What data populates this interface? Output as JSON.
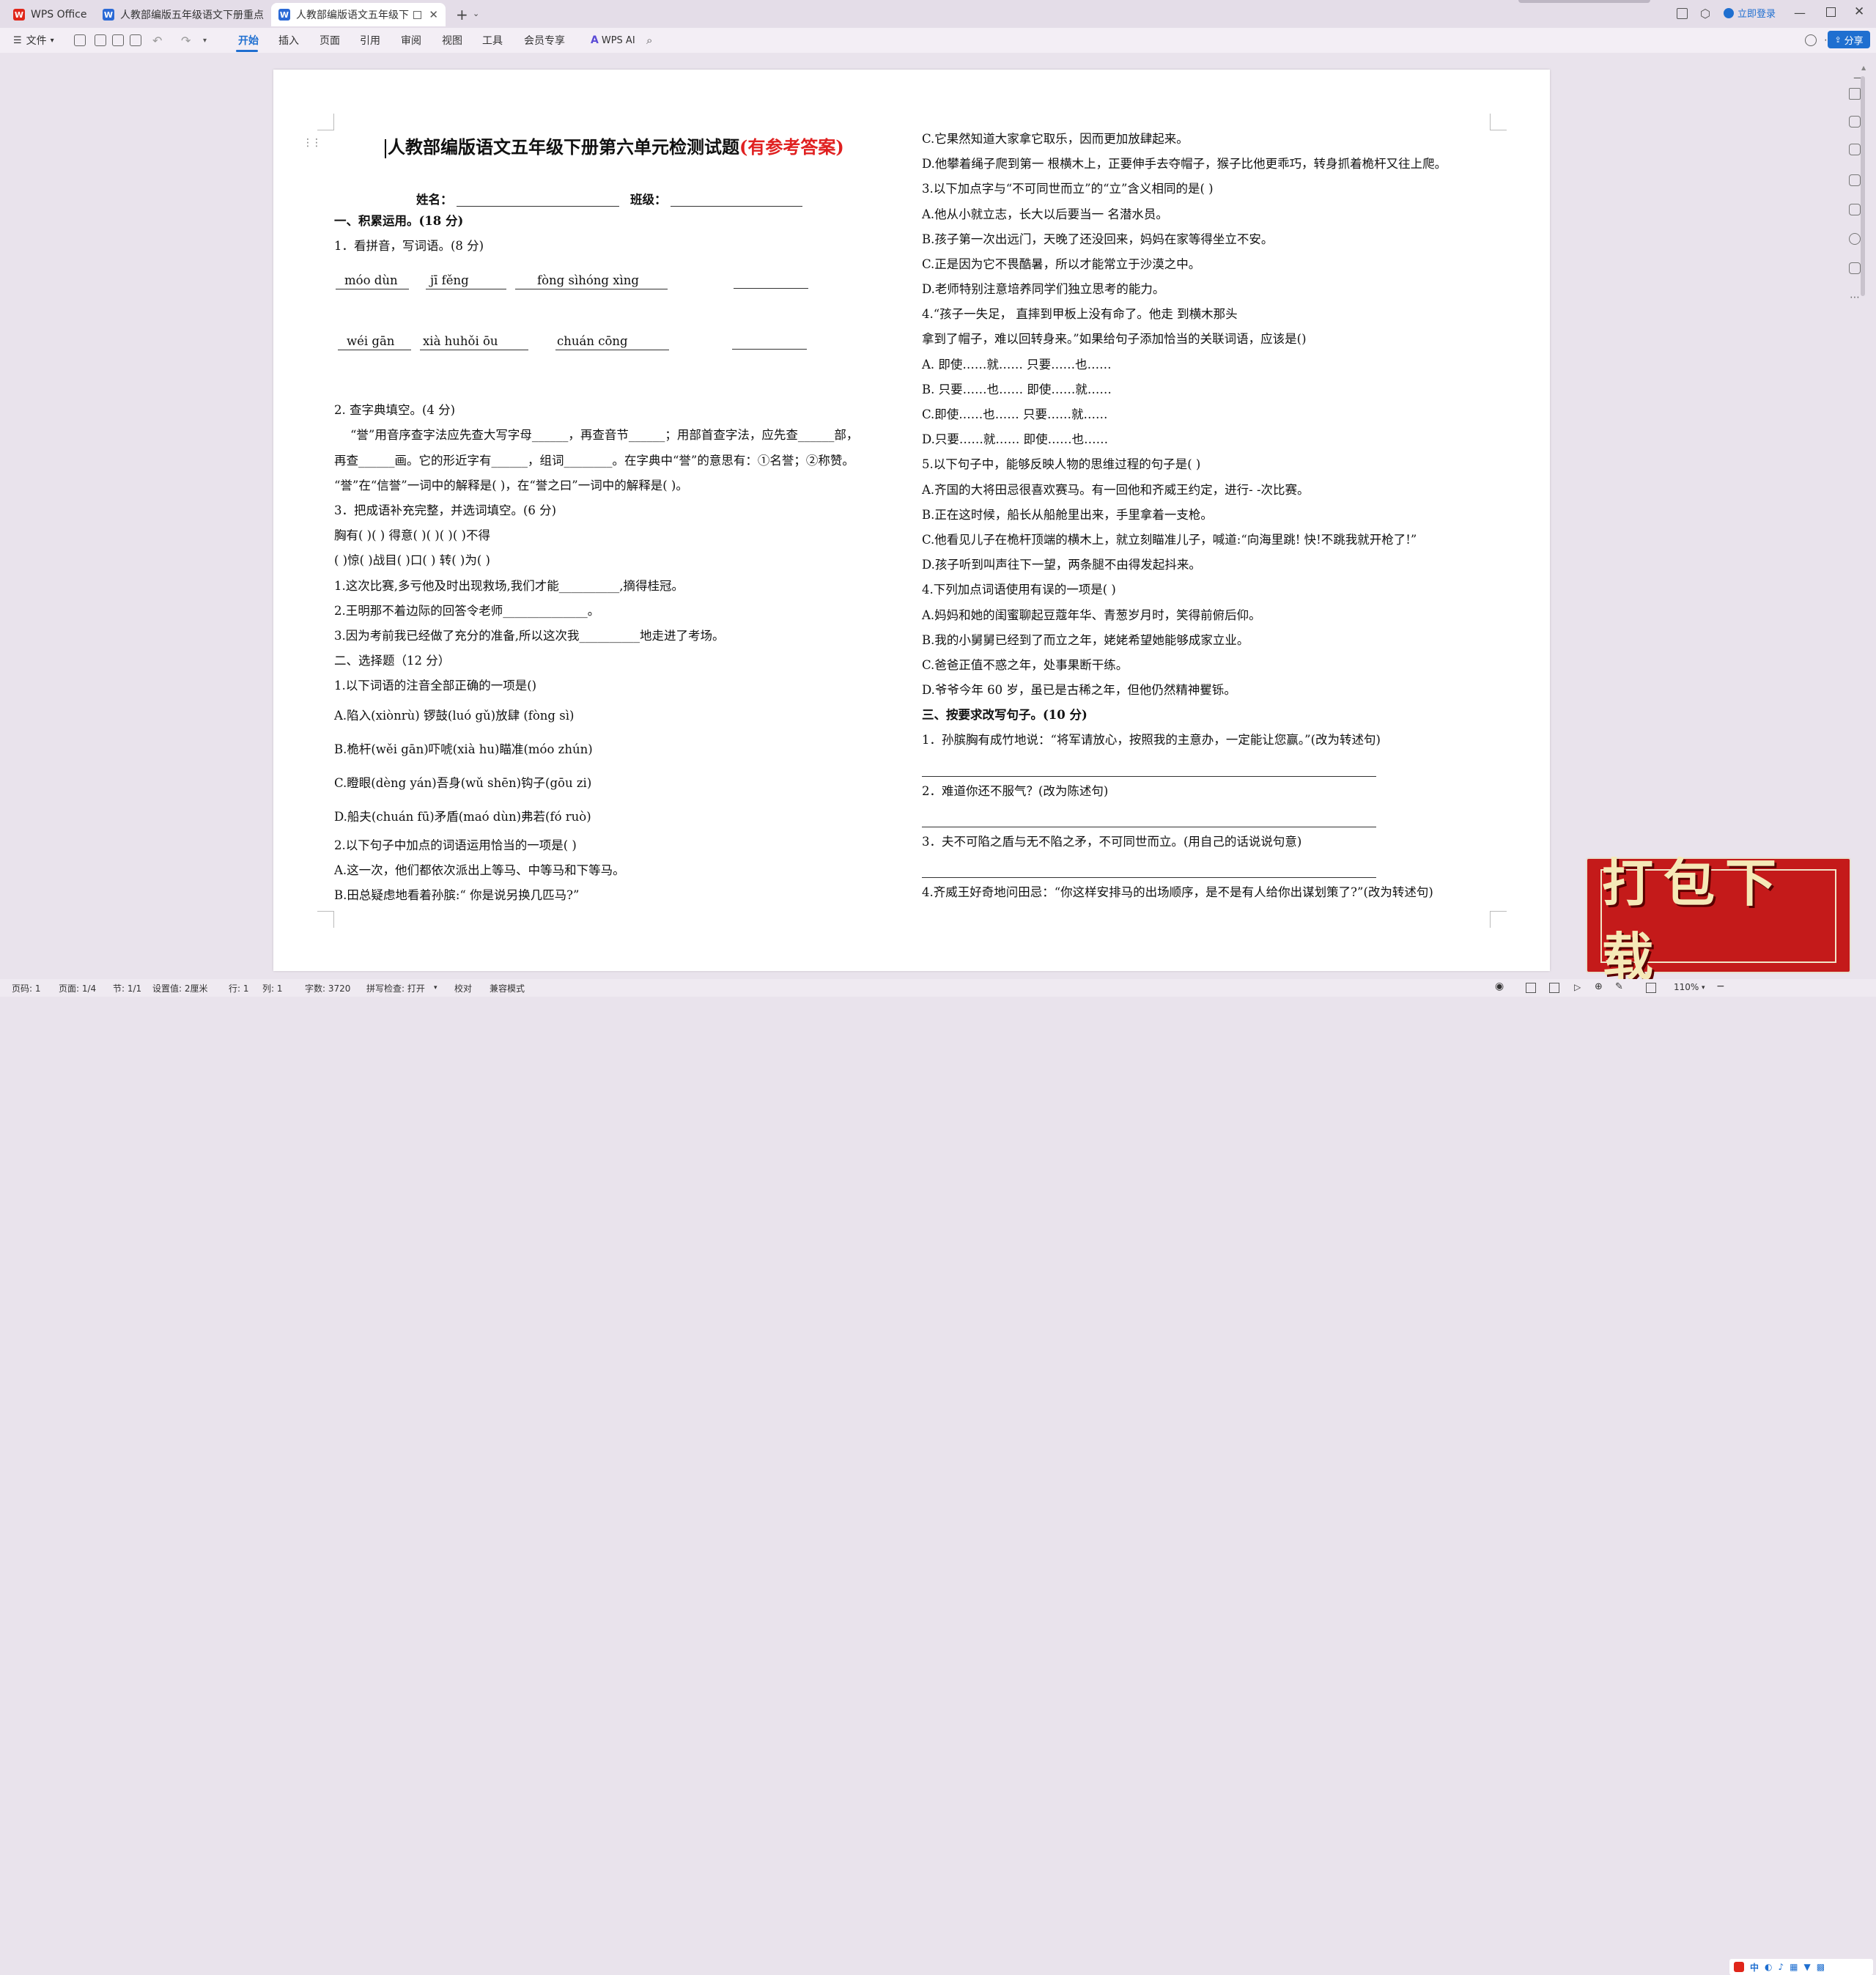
{
  "tabs": [
    {
      "label": "WPS Office"
    },
    {
      "label": "人教部编版五年级语文下册重点学校"
    },
    {
      "label": "人教部编版语文五年级下册第"
    }
  ],
  "titlebar": {
    "login": "立即登录",
    "share": "分享"
  },
  "ribbon": {
    "file": "文件",
    "menus": [
      "开始",
      "插入",
      "页面",
      "引用",
      "审阅",
      "视图",
      "工具",
      "会员专享"
    ],
    "ai": "WPS AI"
  },
  "doc": {
    "title": "人教部编版语文五年级下册第六单元检测试题",
    "title_suffix": "(有参考答案)",
    "name_label": "姓名：",
    "class_label": "班级：",
    "left": [
      {
        "t": "一、积累运用。(18 分)",
        "bold": true
      },
      {
        "t": "1．看拼音，写词语。(8 分)"
      },
      {
        "t": "2. 查字典填空。(4 分)"
      },
      {
        "t": "“誉”用音序查字法应先查大写字母______，再查音节______；用部首查字法，应先查______部，"
      },
      {
        "t": "再查______画。它的形近字有______，组词________。在字典中“誉”的意思有：①名誉；②称赞。"
      },
      {
        "t": "“誉”在“信誉”一词中的解释是(      )，在“誉之曰”一词中的解释是(      )。"
      },
      {
        "t": "3．把成语补充完整，并选词填空。(6 分)"
      },
      {
        "t": "胸有(      )(      )    得意(      )(      )(      )(      )不得"
      },
      {
        "t": "(      )惊(      )战目(      )口(      )    转(      )为(      )"
      },
      {
        "t": "1.这次比赛,多亏他及时出现救场,我们才能__________,摘得桂冠。"
      },
      {
        "t": "2.王明那不着边际的回答令老师______________。"
      },
      {
        "t": "3.因为考前我已经做了充分的准备,所以这次我__________地走进了考场。"
      },
      {
        "t": "二、选择题（12 分）"
      },
      {
        "t": "1.以下词语的注音全部正确的一项是()"
      },
      {
        "t": "A.陷入(xiònrù)  锣鼓(luó  gǔ)放肆  (fòng  sì)"
      },
      {
        "t": "B.桅杆(wěi  gān)吓唬(xià  hu)瞄准(móo  zhún)"
      },
      {
        "t": "C.瞪眼(dèng  yán)吾身(wǔ  shēn)钩子(gōu  zi)"
      },
      {
        "t": "D.船夫(chuán  fū)矛盾(maó  dùn)弗若(fó  ruò)"
      },
      {
        "t": "2.以下句子中加点的词语运用恰当的一项是(    )"
      },
      {
        "t": "A.这一次，他们都依次派出上等马、中等马和下等马。"
      },
      {
        "t": "B.田总疑虑地看着孙膑:“  你是说另换几匹马?”"
      }
    ],
    "pinyin_row1": [
      "móo  dùn",
      "jī  fěng",
      "fòng  sìhóng  xìng"
    ],
    "pinyin_row2": [
      "wéi  gān",
      "xià  huhǒi  ōu",
      "chuán  cōng"
    ],
    "right": [
      {
        "t": "C.它果然知道大家拿它取乐，因而更加放肆起来。"
      },
      {
        "t": "D.他攀着绳子爬到第一  根横木上，正要伸手去夺帽子，猴子比他更乖巧，转身抓着桅杆又往上爬。"
      },
      {
        "t": "3.以下加点字与“不可同世而立”的“立”含义相同的是(    )"
      },
      {
        "t": "A.他从小就立志，长大以后要当一  名潜水员。"
      },
      {
        "t": "B.孩子第一次出远门，天晚了还没回来，妈妈在家等得坐立不安。"
      },
      {
        "t": "C.正是因为它不畏酷暑，所以才能常立于沙漠之中。"
      },
      {
        "t": "D.老师特别注意培养同学们独立思考的能力。"
      },
      {
        "t": "4.“孩子一失足，  直摔到甲板上没有命了。他走  到横木那头"
      },
      {
        "t": "拿到了帽子，难以回转身来。”如果给句子添加恰当的关联词语，应该是()"
      },
      {
        "t": "A.  即使……就……          只要……也……"
      },
      {
        "t": "B.  只要……也……          即使……就……"
      },
      {
        "t": "C.即使……也……            只要……就……"
      },
      {
        "t": "D.只要……就……            即使……也……"
      },
      {
        "t": "5.以下句子中，能够反映人物的思维过程的句子是(    )"
      },
      {
        "t": "A.齐国的大将田忌很喜欢赛马。有一回他和齐威王约定，进行-  -次比赛。"
      },
      {
        "t": "B.正在这时候，船长从船舱里出来，手里拿着一支枪。"
      },
      {
        "t": "C.他看见儿子在桅杆顶端的横木上，就立刻瞄准儿子，喊道:“向海里跳!  快!不跳我就开枪了!”"
      },
      {
        "t": "D.孩子听到叫声往下一望，两条腿不由得发起抖来。"
      },
      {
        "t": "4.下列加点词语使用有误的一项是(    )"
      },
      {
        "t": "A.妈妈和她的闺蜜聊起豆蔻年华、青葱岁月时，笑得前俯后仰。"
      },
      {
        "t": "B.我的小舅舅已经到了而立之年，姥姥希望她能够成家立业。"
      },
      {
        "t": "C.爸爸正值不惑之年，处事果断干练。"
      },
      {
        "t": "D.爷爷今年 60 岁，虽已是古稀之年，但他仍然精神矍铄。"
      },
      {
        "t": "三、按要求改写句子。(10 分)",
        "bold": true
      },
      {
        "t": "1．孙膑胸有成竹地说：“将军请放心，按照我的主意办，一定能让您赢。”(改为转述句)"
      },
      {
        "t": "2．难道你还不服气？(改为陈述句)"
      },
      {
        "t": "3．夫不可陷之盾与无不陷之矛，不可同世而立。(用自己的话说说句意)"
      },
      {
        "t": "4.齐威王好奇地问田忌：“你这样安排马的出场顺序，是不是有人给你出谋划策了?”(改为转述句)"
      }
    ]
  },
  "status": {
    "page_info": "页码: 1",
    "page_count": "页面: 1/4",
    "section": "节: 1/1",
    "setting": "设置值: 2厘米",
    "row": "行: 1",
    "col": "列: 1",
    "word_count": "字数: 3720",
    "spell": "拼写检查: 打开",
    "proof": "校对",
    "compat": "兼容模式",
    "zoom": "110%"
  },
  "badge": {
    "text": "打包下载"
  },
  "colors": {
    "accent": "#1f6fd0",
    "title_red": "#e02020",
    "badge_red": "#c41a1a"
  }
}
